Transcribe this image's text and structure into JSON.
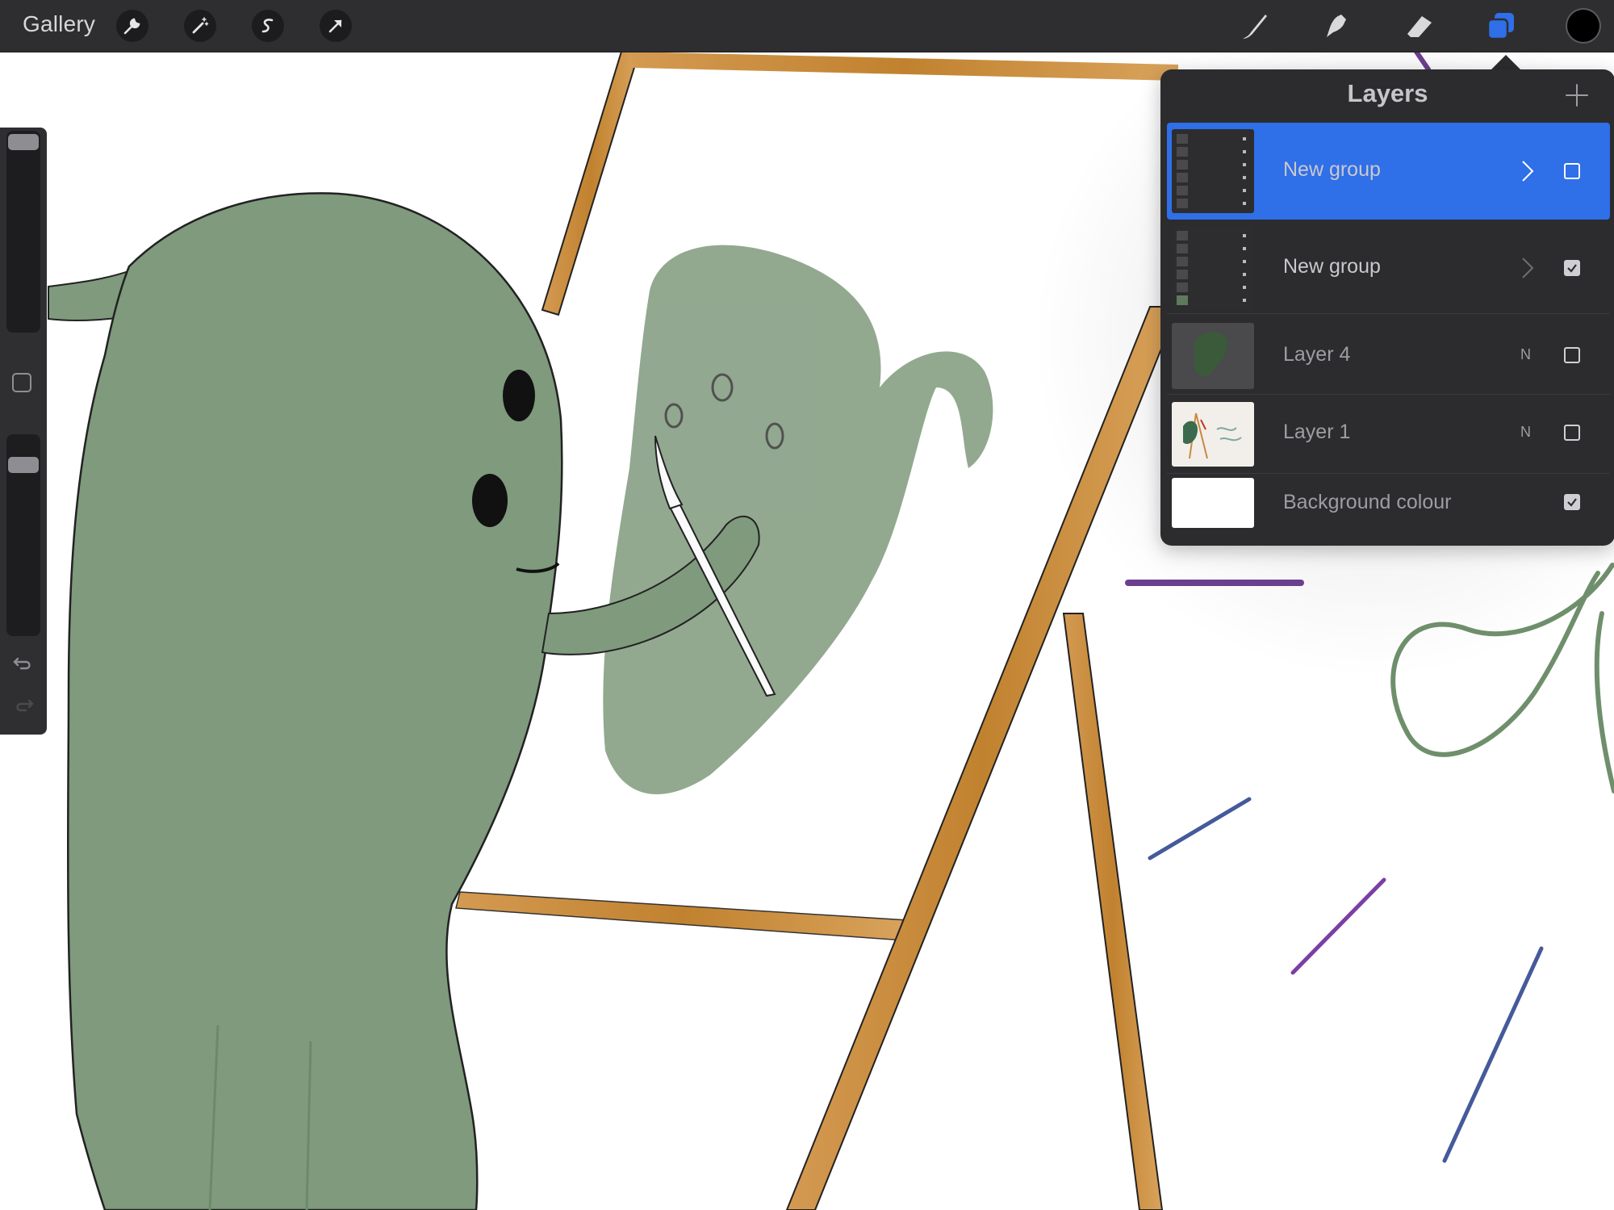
{
  "toolbar": {
    "gallery_label": "Gallery",
    "left_tools": [
      "wrench-icon",
      "magic-wand-icon",
      "selection-icon",
      "transform-arrow-icon"
    ],
    "right_tools": [
      "brush-icon",
      "smudge-icon",
      "eraser-icon",
      "layers-icon"
    ],
    "accent": "#2f6fe8",
    "current_color": "#000000"
  },
  "sidebar": {
    "controls": [
      "brush-size-slider",
      "modify-button",
      "opacity-slider",
      "undo-icon",
      "redo-icon"
    ]
  },
  "layers_panel": {
    "title": "Layers",
    "add_icon": "plus-icon",
    "rows": [
      {
        "name": "New group",
        "kind": "group",
        "selected": true,
        "visible": false
      },
      {
        "name": "New group",
        "kind": "group",
        "selected": false,
        "visible": true
      },
      {
        "name": "Layer 4",
        "kind": "layer",
        "blend": "N",
        "selected": false,
        "visible": false
      },
      {
        "name": "Layer 1",
        "kind": "layer",
        "blend": "N",
        "selected": false,
        "visible": false
      },
      {
        "name": "Background colour",
        "kind": "background",
        "selected": false,
        "visible": true
      }
    ]
  },
  "canvas": {
    "colors": {
      "monster_green": "#7f9a7d",
      "easel_wood": "#c8893e",
      "purple_stroke": "#6b3f8e",
      "blue_stroke": "#455a9b",
      "loop_green": "#6f8f6c"
    }
  }
}
